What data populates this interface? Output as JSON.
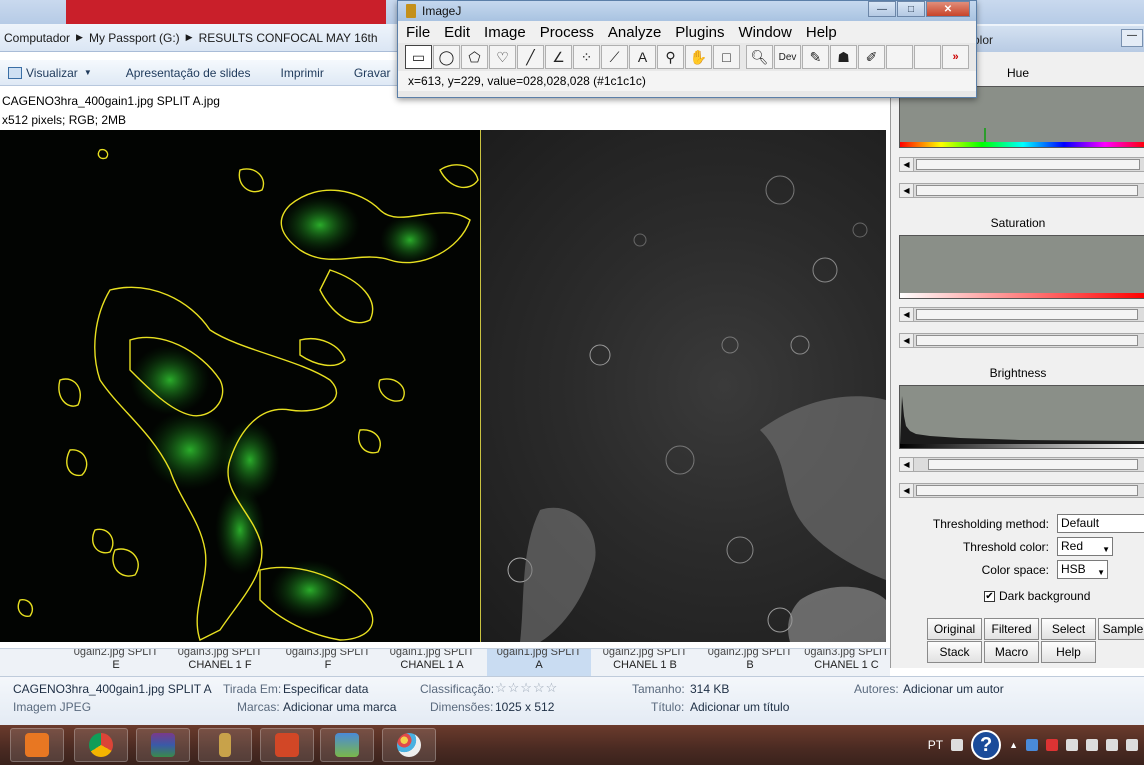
{
  "explorer": {
    "breadcrumb": [
      "Computador",
      "My Passport (G:)",
      "RESULTS CONFOCAL MAY 16th"
    ],
    "toolbar": {
      "view": "Visualizar",
      "slideshow": "Apresentação de slides",
      "print": "Imprimir",
      "burn": "Gravar"
    },
    "image_title": "CAGENO3hra_400gain1.jpg SPLIT A.jpg",
    "image_info": "x512 pixels; RGB; 2MB",
    "thumbnails": [
      {
        "line1": "0gain2.jpg SPLIT",
        "line2": "E"
      },
      {
        "line1": "0gain3.jpg SPLIT",
        "line2": "CHANEL 1 F"
      },
      {
        "line1": "0gain3.jpg SPLIT",
        "line2": "F"
      },
      {
        "line1": "0gain1.jpg SPLIT",
        "line2": "CHANEL 1 A"
      },
      {
        "line1": "0gain1.jpg SPLIT",
        "line2": "A"
      },
      {
        "line1": "0gain2.jpg SPLIT",
        "line2": "CHANEL 1 B"
      },
      {
        "line1": "0gain2.jpg SPLIT",
        "line2": "B"
      },
      {
        "line1": "0gain3.jpg SPLIT",
        "line2": "CHANEL 1 C"
      }
    ],
    "details": {
      "filename": "CAGENO3hra_400gain1.jpg SPLIT A",
      "filetype": "Imagem JPEG",
      "date_taken_label": "Tirada Em:",
      "date_taken_value": "Especificar data",
      "tags_label": "Marcas:",
      "tags_value": "Adicionar uma marca",
      "rating_label": "Classificação:",
      "rating_stars": "☆☆☆☆☆",
      "dimensions_label": "Dimensões:",
      "dimensions_value": "1025 x 512",
      "size_label": "Tamanho:",
      "size_value": "314 KB",
      "title_label": "Título:",
      "title_value": "Adicionar um título",
      "authors_label": "Autores:",
      "authors_value": "Adicionar um autor"
    }
  },
  "imagej": {
    "title": "ImageJ",
    "menus": [
      "File",
      "Edit",
      "Image",
      "Process",
      "Analyze",
      "Plugins",
      "Window",
      "Help"
    ],
    "dev_tool_label": "Dev",
    "more_label": "»",
    "status": "x=613, y=229, value=028,028,028 (#1c1c1c)"
  },
  "threshold": {
    "window_title": "olor",
    "hue_label": "Hue",
    "saturation_label": "Saturation",
    "brightness_label": "Brightness",
    "method_label": "Thresholding method:",
    "method_value": "Default",
    "color_label": "Threshold color:",
    "color_value": "Red",
    "space_label": "Color space:",
    "space_value": "HSB",
    "dark_bg_label": "Dark background",
    "dark_bg_checked": true,
    "buttons_row1": [
      "Original",
      "Filtered",
      "Select",
      "Sample"
    ],
    "buttons_row2": [
      "Stack",
      "Macro",
      "Help"
    ]
  },
  "taskbar": {
    "language": "PT",
    "help_glyph": "?"
  }
}
